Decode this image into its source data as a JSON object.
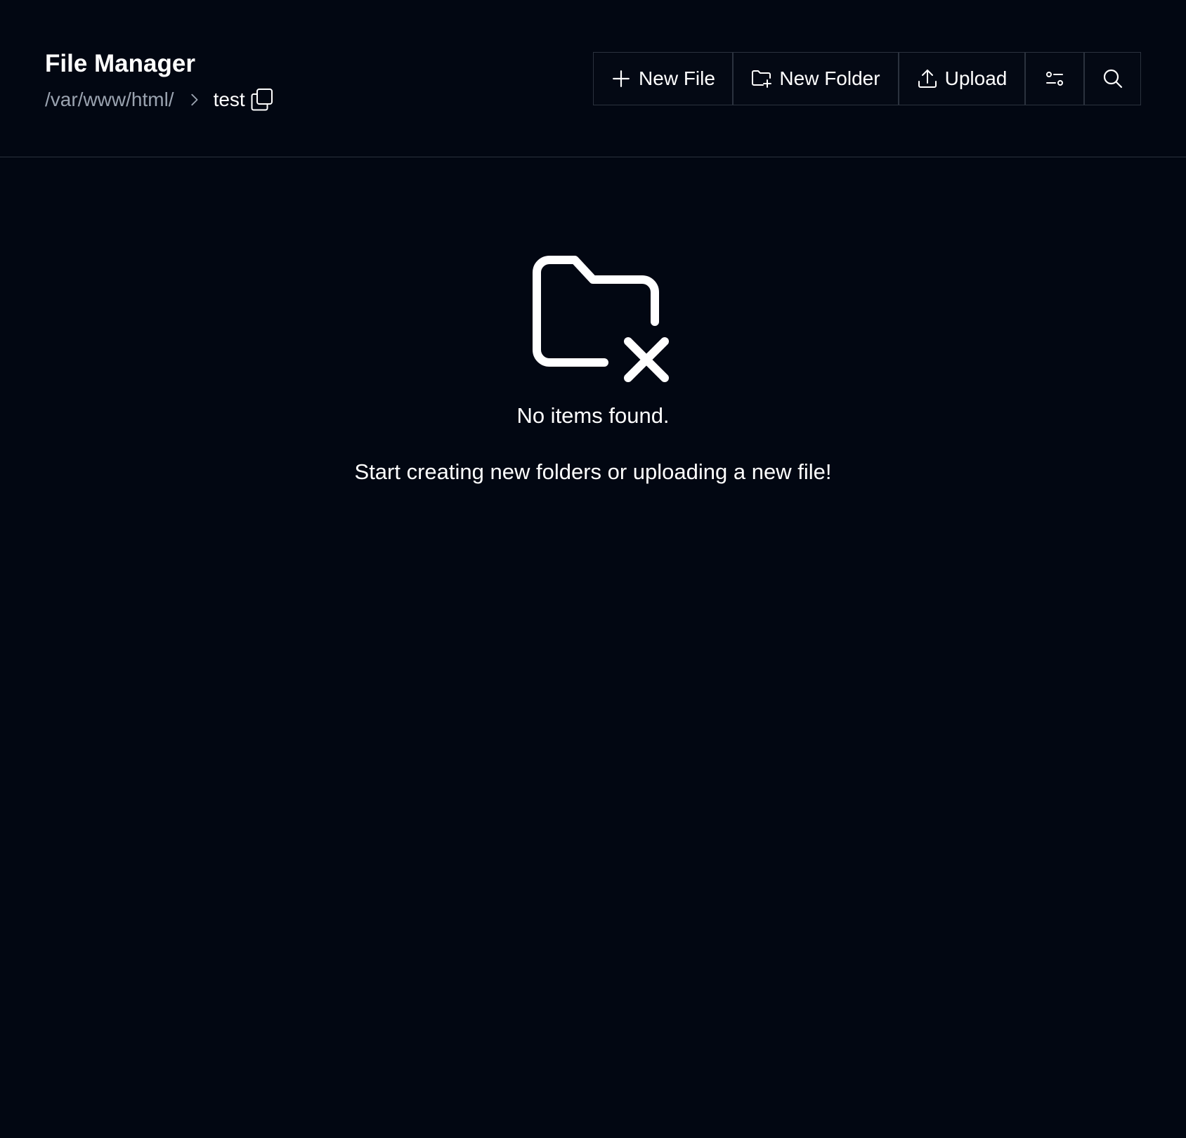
{
  "header": {
    "title": "File Manager",
    "breadcrumb": {
      "parent": "/var/www/html/",
      "current": "test"
    }
  },
  "toolbar": {
    "new_file_label": "New File",
    "new_folder_label": "New Folder",
    "upload_label": "Upload"
  },
  "empty_state": {
    "title": "No items found.",
    "subtitle": "Start creating new folders or uploading a new file!"
  },
  "icons": {
    "copy": "copy-icon",
    "chevron": "chevron-right-icon",
    "new_file": "plus-icon",
    "new_folder": "folder-plus-icon",
    "upload": "upload-icon",
    "settings": "sliders-icon",
    "search": "search-icon",
    "empty": "folder-x-icon"
  },
  "colors": {
    "background": "#020712",
    "text": "#ffffff",
    "muted": "#9aa3b0",
    "border": "#2b323e"
  }
}
